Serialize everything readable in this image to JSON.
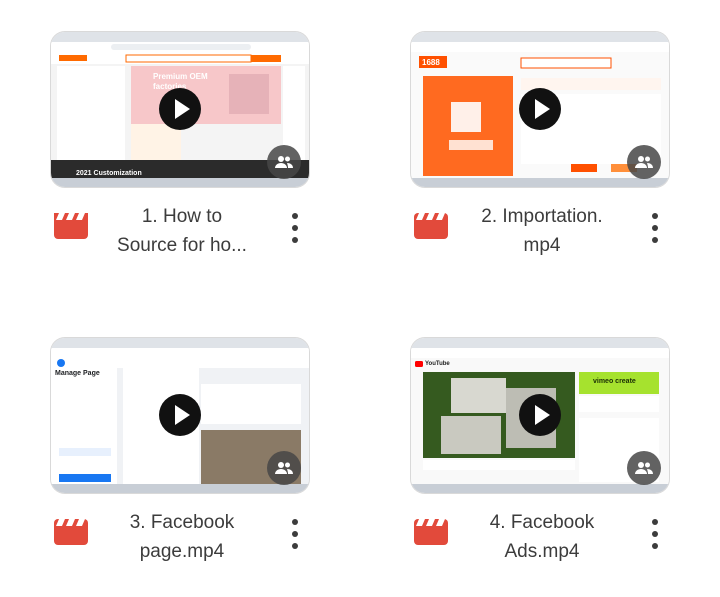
{
  "files": [
    {
      "title_line1": "1. How to",
      "title_line2": "Source for ho...",
      "thumb_text": "Premium OEM factories",
      "thumb_sub": "2021 Customization"
    },
    {
      "title_line1": "2. Importation.",
      "title_line2": "mp4",
      "thumb_text": "1688",
      "thumb_sub": ""
    },
    {
      "title_line1": "3. Facebook",
      "title_line2": "page.mp4",
      "thumb_text": "Manage Page",
      "thumb_sub": ""
    },
    {
      "title_line1": "4. Facebook",
      "title_line2": "Ads.mp4",
      "thumb_text": "YouTube",
      "thumb_sub": "vimeo create"
    }
  ],
  "icons": {
    "video": "video-file-icon",
    "play": "play-icon",
    "shared": "shared-people-icon",
    "more": "more-vert-icon"
  },
  "colors": {
    "video_icon": "#e24a3b",
    "text": "#3c3c3c",
    "alibaba_orange": "#ff6a00",
    "facebook_blue": "#1877f2",
    "youtube_red": "#ff0000"
  }
}
